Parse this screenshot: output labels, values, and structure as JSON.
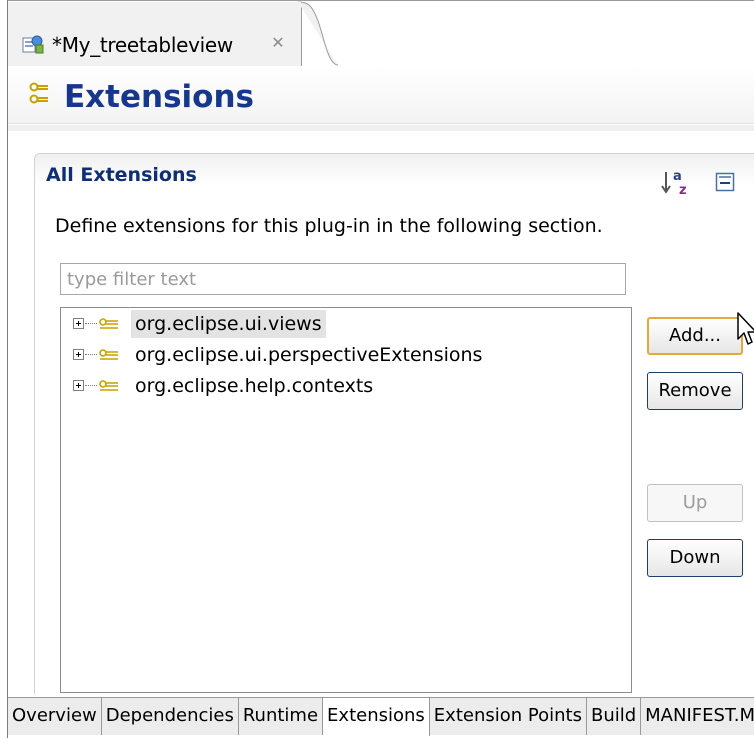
{
  "editor_tab": {
    "title": "*My_treetableview",
    "close_icon": "close-icon",
    "icon": "plugin-manifest-icon"
  },
  "header": {
    "title": "Extensions",
    "icon": "extensions-icon"
  },
  "section": {
    "title": "All Extensions",
    "description": "Define extensions for this plug-in in the following section.",
    "toolbar": {
      "sort_icon": "sort-alphabetically-icon",
      "collapse_icon": "collapse-all-icon"
    }
  },
  "filter": {
    "placeholder": "type filter text",
    "value": ""
  },
  "tree": {
    "items": [
      {
        "label": "org.eclipse.ui.views",
        "selected": true
      },
      {
        "label": "org.eclipse.ui.perspectiveExtensions",
        "selected": false
      },
      {
        "label": "org.eclipse.help.contexts",
        "selected": false
      }
    ]
  },
  "buttons": {
    "add": "Add...",
    "remove": "Remove",
    "up": "Up",
    "down": "Down"
  },
  "bottom_tabs": [
    {
      "label": "Overview",
      "active": false
    },
    {
      "label": "Dependencies",
      "active": false
    },
    {
      "label": "Runtime",
      "active": false
    },
    {
      "label": "Extensions",
      "active": true
    },
    {
      "label": "Extension Points",
      "active": false
    },
    {
      "label": "Build",
      "active": false
    },
    {
      "label": "MANIFEST.MF",
      "active": false
    }
  ],
  "colors": {
    "title": "#16378d",
    "section_title": "#0f2f74",
    "focus_border": "#e6a83a",
    "extension_icon": "#c9a100"
  }
}
